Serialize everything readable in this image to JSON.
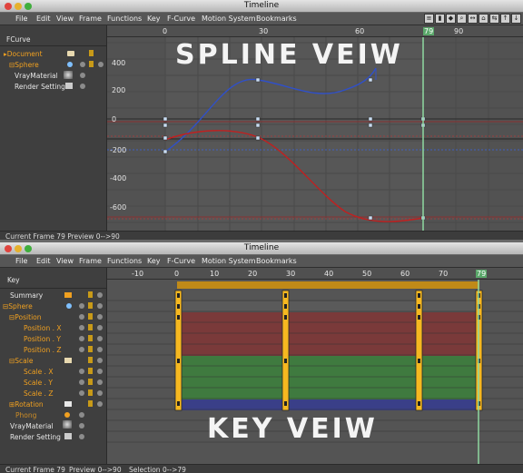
{
  "spline_window": {
    "title": "Timeline",
    "menu": [
      "File",
      "Edit",
      "View",
      "Frame",
      "Functions",
      "Key",
      "F-Curve",
      "Motion System",
      "Bookmarks"
    ],
    "panel_header": "FCurve",
    "tree": {
      "document": "Document",
      "sphere": "Sphere",
      "vray_material": "VrayMaterial",
      "render_setting": "Render Setting"
    },
    "ruler_labels": [
      "0",
      "30",
      "60",
      "79",
      "90"
    ],
    "y_labels": [
      "400",
      "200",
      "0",
      "-200",
      "-400",
      "-600"
    ],
    "overlay": "SPLINE VEIW",
    "status": "Current Frame 79 Preview 0-->90"
  },
  "key_window": {
    "title": "Timeline",
    "menu": [
      "File",
      "Edit",
      "View",
      "Frame",
      "Functions",
      "Key",
      "F-Curve",
      "Motion System",
      "Bookmarks"
    ],
    "panel_header": "Key",
    "tree": {
      "summary": "Summary",
      "sphere": "Sphere",
      "position": "Position",
      "position_x": "Position . X",
      "position_y": "Position . Y",
      "position_z": "Position . Z",
      "scale": "Scale",
      "scale_x": "Scale . X",
      "scale_y": "Scale . Y",
      "scale_z": "Scale . Z",
      "rotation": "Rotation",
      "phong": "Phong",
      "vray_material": "VrayMaterial",
      "render_setting": "Render Setting"
    },
    "ruler_labels": [
      "-10",
      "0",
      "10",
      "20",
      "30",
      "40",
      "50",
      "60",
      "70",
      "79"
    ],
    "overlay": "KEY VEIW",
    "status": {
      "current_frame": "Current Frame 79",
      "preview": "Preview 0-->90",
      "selection": "Selection 0-->79"
    }
  },
  "colors": {
    "accent_orange": "#f0a020",
    "playhead_green": "#8ed8a0",
    "curve_blue": "#3050c8",
    "curve_red": "#c02020",
    "track_red": "#7a3a3a",
    "track_green": "#3f7a3f",
    "track_blue": "#3a3f88",
    "key_yellow": "#f6b820"
  },
  "icons": [
    "sort-icon",
    "zoom-icon",
    "home-icon",
    "fit-icon",
    "arrow-icon"
  ]
}
